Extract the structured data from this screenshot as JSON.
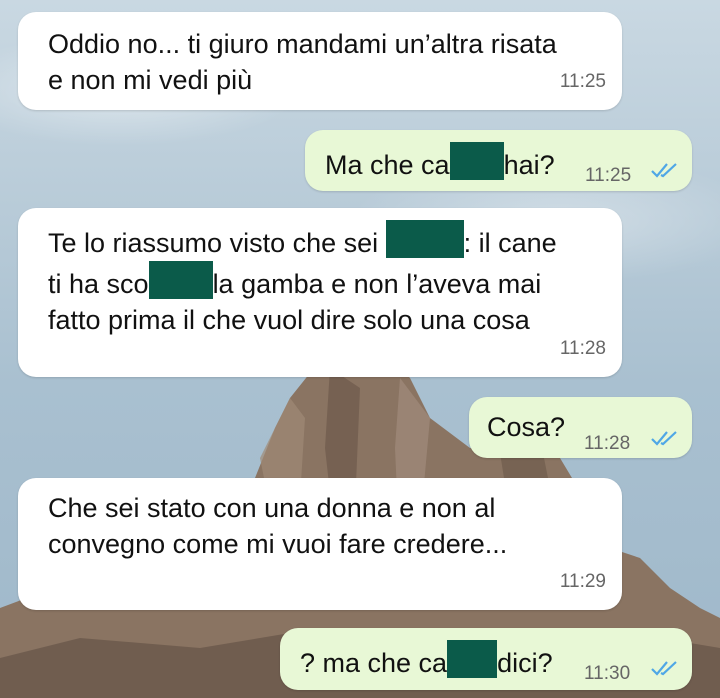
{
  "messages": [
    {
      "direction": "in",
      "lines": [
        "Oddio no... ti giuro mandami un’altra risata",
        "e non mi vedi più"
      ],
      "time": "11:25"
    },
    {
      "direction": "out",
      "parts": [
        "Ma che ca",
        "hai?"
      ],
      "time": "11:25",
      "status": "read"
    },
    {
      "direction": "in",
      "lines": [
        [
          "Te lo riassumo visto che sei ",
          ": il cane"
        ],
        [
          "ti ha sco",
          "la gamba e non l’aveva mai"
        ],
        "fatto prima il che vuol dire solo una cosa"
      ],
      "time": "11:28"
    },
    {
      "direction": "out",
      "text": "Cosa?",
      "time": "11:28",
      "status": "read"
    },
    {
      "direction": "in",
      "lines": [
        "Che sei stato con una donna e non al",
        "convegno come mi vuoi fare credere..."
      ],
      "time": "11:29"
    },
    {
      "direction": "out",
      "parts": [
        "? ma che ca",
        "dici?"
      ],
      "time": "11:30",
      "status": "read"
    }
  ],
  "colors": {
    "incoming": "#ffffff",
    "outgoing": "#e8f8d6",
    "redaction": "#0b5b4a",
    "read_ticks": "#4fa7e6"
  }
}
